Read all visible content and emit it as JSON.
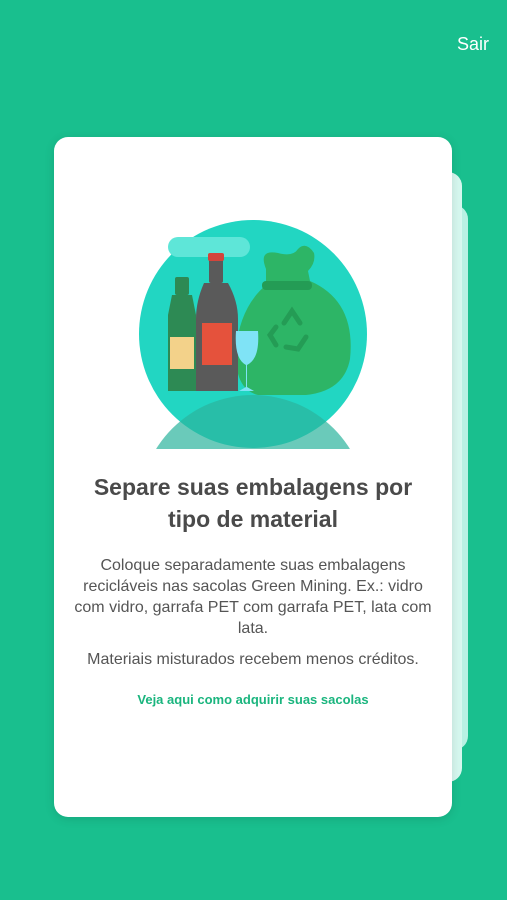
{
  "header": {
    "exit_label": "Sair"
  },
  "onboarding": {
    "title": "Separe suas embalagens por tipo de material",
    "description": "Coloque separadamente suas embalagens recicláveis nas sacolas Green Mining. Ex.: vidro com vidro, garrafa PET com garrafa PET, lata com lata.",
    "note": "Materiais misturados recebem menos créditos.",
    "link_label": "Veja aqui como adquirir suas sacolas",
    "illustration_icon": "recycling-bags-bottles-illustration"
  },
  "colors": {
    "background": "#19bf8e",
    "accent": "#1ab57e",
    "card": "#ffffff"
  }
}
